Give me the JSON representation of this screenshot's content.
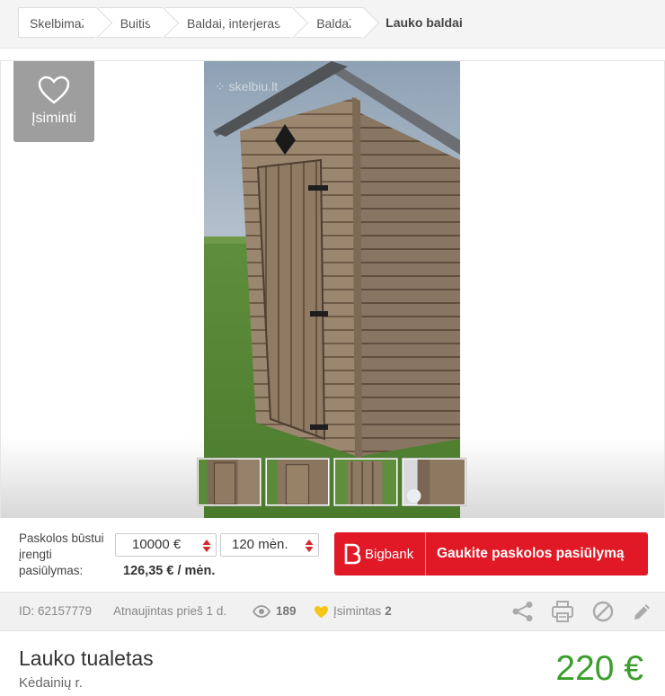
{
  "breadcrumb": {
    "items": [
      "Skelbimai",
      "Buitis",
      "Baldai, interjeras",
      "Baldai"
    ],
    "current": "Lauko baldai"
  },
  "gallery": {
    "save_label": "Įsiminti",
    "thumbnail_count": 4
  },
  "loan": {
    "label": "Paskolos būstui įrengti pasiūlymas:",
    "amount": "10000 €",
    "term": "120 mėn.",
    "monthly": "126,35 € / mėn.",
    "lender": "Bigbank",
    "cta": "Gaukite paskolos pasiūlymą"
  },
  "meta": {
    "id": "ID: 62157779",
    "updated": "Atnaujintas prieš 1 d.",
    "views": "189",
    "saved_label": "Įsimintas",
    "saved_count": "2"
  },
  "listing": {
    "title": "Lauko tualetas",
    "location": "Kėdainių r.",
    "price": "220 €"
  },
  "colors": {
    "bigbank": "#e11926",
    "price": "#3a9e2b",
    "save_button": "#9e9e9e"
  }
}
